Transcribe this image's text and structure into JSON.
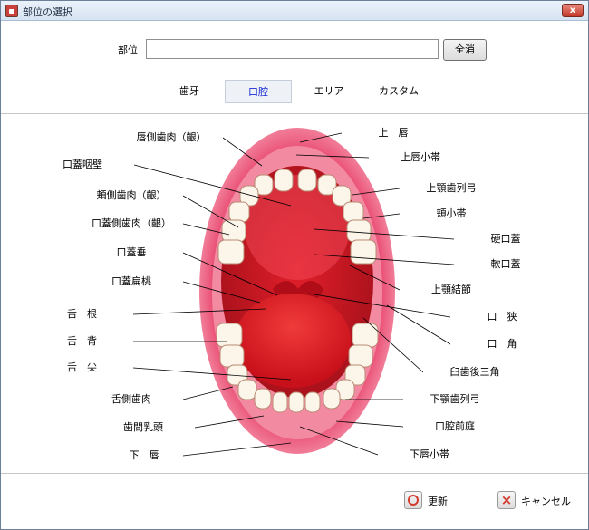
{
  "window": {
    "title": "部位の選択",
    "close_glyph": "x"
  },
  "field": {
    "label": "部位",
    "value": "",
    "placeholder": "",
    "clear_label": "全消"
  },
  "tabs": [
    {
      "label": "歯牙",
      "active": false
    },
    {
      "label": "口腔",
      "active": true
    },
    {
      "label": "エリア",
      "active": false
    },
    {
      "label": "カスタム",
      "active": false
    }
  ],
  "labels": {
    "kuchibiru_shinikuseki": "唇側歯肉（齦）",
    "koukuuteiheki": "口蓋咽壁",
    "kyoushokushiniku": "頬側歯肉（齦）",
    "koukaisokushiniku": "口蓋側歯肉（齦）",
    "koukaisui": "口蓋垂",
    "koukaihentou": "口蓋扁桃",
    "zetsukon": "舌　根",
    "zetsuhai": "舌　背",
    "zessen": "舌　尖",
    "zetsusokushiniku": "舌側歯肉",
    "shikannyuutou": "歯間乳頭",
    "kashin": "下　唇",
    "joushin": "上　唇",
    "joushinshoutai": "上唇小帯",
    "jougakushiretsukyuu": "上顎歯列弓",
    "kyoushoutai": "頬小帯",
    "koukoukai": "硬口蓋",
    "nankoukai": "軟口蓋",
    "jougakuketsusetsu": "上顎結節",
    "koukyou": "口　狭",
    "koukaku": "口　角",
    "kyuushikousankaku": "臼歯後三角",
    "kagakushiretsukyuu": "下顎歯列弓",
    "koukuuzentei": "口腔前庭",
    "kashinshoutai": "下唇小帯"
  },
  "buttons": {
    "renew": "更新",
    "cancel": "キャンセル"
  },
  "colors": {
    "lip": "#e33a5c",
    "mouth_red": "#d81522",
    "tongue": "#e8121c",
    "tooth": "#fbf5ea",
    "active_tab": "#1a2bd6"
  }
}
